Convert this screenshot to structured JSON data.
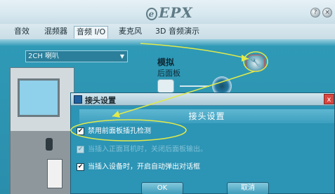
{
  "header": {
    "logo_mark": "e",
    "logo_text": "EPX",
    "help_label": "?",
    "close_label": "×"
  },
  "tabs": [
    {
      "label": "音效"
    },
    {
      "label": "混频器"
    },
    {
      "label": "音频 I/O",
      "active": true
    },
    {
      "label": "麦克风"
    },
    {
      "label": "3D 音频演示"
    }
  ],
  "main": {
    "speaker_config": "2CH 喇叭",
    "analog_label": "模拟",
    "rear_panel_label": "后面板",
    "settings_icon": "wrench-icon"
  },
  "dialog": {
    "title": "接头设置",
    "close_label": "x",
    "banner": "接头设置",
    "options": [
      {
        "label": "禁用前面板插孔检测",
        "checked": true,
        "enabled": true
      },
      {
        "label": "当插入正面耳机时，关闭后面板输出。",
        "checked": true,
        "enabled": false
      },
      {
        "label": "当插入设备时，开启自动弹出对话框",
        "checked": true,
        "enabled": true
      }
    ],
    "ok_label": "OK",
    "cancel_label": "取消",
    "check_mark": "✔"
  },
  "annotation": {
    "color": "#e2ea4a"
  }
}
